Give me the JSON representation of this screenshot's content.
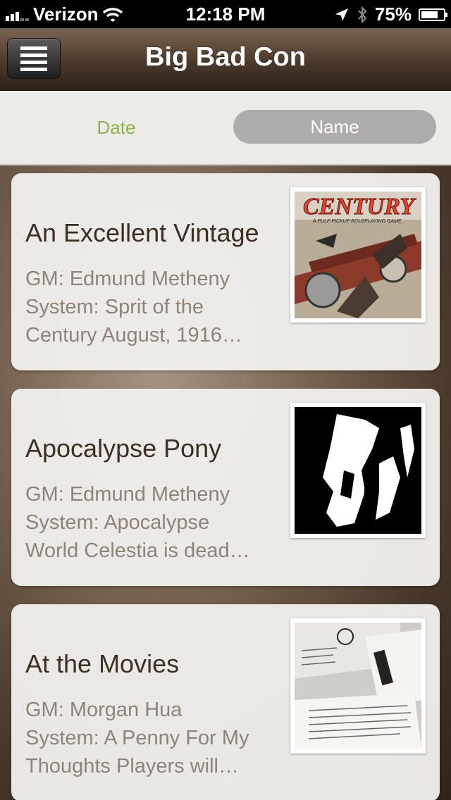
{
  "status_bar": {
    "carrier": "Verizon",
    "time": "12:18 PM",
    "battery": "75%",
    "battery_level": 0.75
  },
  "nav": {
    "title": "Big Bad Con",
    "menu_icon": "hamburger-menu-icon"
  },
  "sort": {
    "options": [
      "Date",
      "Name"
    ],
    "selected": "Name"
  },
  "events": [
    {
      "title": "An Excellent Vintage",
      "desc_lines": [
        "GM: Edmund Metheny",
        "System: Sprit of the",
        "Century August, 1916…"
      ],
      "thumb_text": "CENTURY",
      "thumb_subtext": "A PULP PICKUP ROLEPLAYING GAME"
    },
    {
      "title": "Apocalypse Pony",
      "desc_lines": [
        "GM: Edmund Metheny",
        "System: Apocalypse",
        "World Celestia is dead…"
      ]
    },
    {
      "title": "At the Movies",
      "desc_lines": [
        "GM: Morgan Hua",
        "System: A Penny For My",
        "Thoughts Players will…"
      ]
    }
  ]
}
